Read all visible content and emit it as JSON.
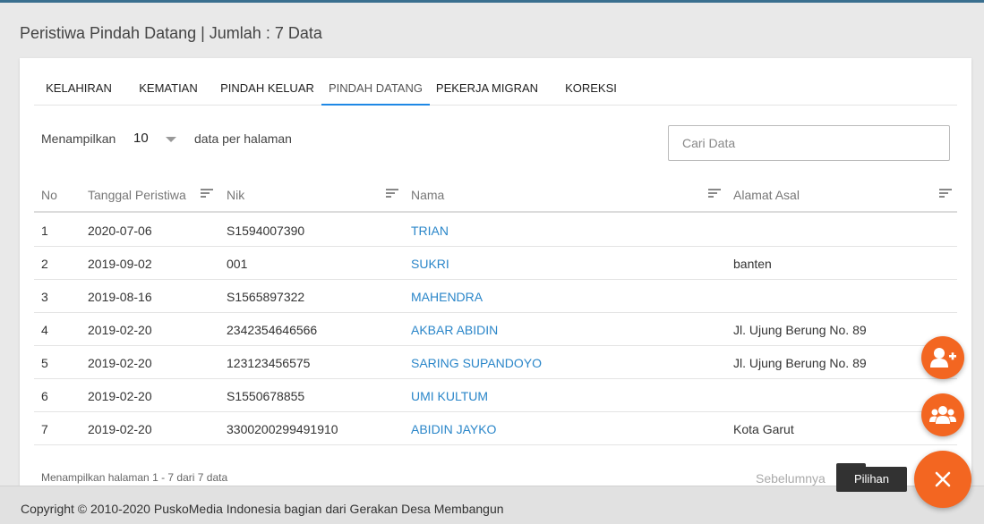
{
  "page": {
    "title": "Peristiwa Pindah Datang | Jumlah : 7 Data"
  },
  "tabs": [
    {
      "label": "KELAHIRAN"
    },
    {
      "label": "KEMATIAN"
    },
    {
      "label": "PINDAH KELUAR"
    },
    {
      "label": "PINDAH DATANG",
      "active": true
    },
    {
      "label": "PEKERJA MIGRAN"
    },
    {
      "label": "KOREKSI"
    }
  ],
  "controls": {
    "show_label": "Menampilkan",
    "page_size": "10",
    "per_page_label": "data per halaman",
    "search_placeholder": "Cari Data"
  },
  "table": {
    "columns": [
      "No",
      "Tanggal Peristiwa",
      "Nik",
      "Nama",
      "Alamat Asal"
    ],
    "rows": [
      {
        "no": "1",
        "tanggal": "2020-07-06",
        "nik": "S1594007390",
        "nama": "TRIAN",
        "alamat": ""
      },
      {
        "no": "2",
        "tanggal": "2019-09-02",
        "nik": "001",
        "nama": "SUKRI",
        "alamat": "banten"
      },
      {
        "no": "3",
        "tanggal": "2019-08-16",
        "nik": "S1565897322",
        "nama": "MAHENDRA",
        "alamat": ""
      },
      {
        "no": "4",
        "tanggal": "2019-02-20",
        "nik": "2342354646566",
        "nama": "AKBAR ABIDIN",
        "alamat": "Jl. Ujung Berung No. 89"
      },
      {
        "no": "5",
        "tanggal": "2019-02-20",
        "nik": "123123456575",
        "nama": "SARING SUPANDOYO",
        "alamat": "Jl. Ujung Berung No. 89"
      },
      {
        "no": "6",
        "tanggal": "2019-02-20",
        "nik": "S1550678855",
        "nama": "UMI KULTUM",
        "alamat": ""
      },
      {
        "no": "7",
        "tanggal": "2019-02-20",
        "nik": "3300200299491910",
        "nama": "ABIDIN JAYKO",
        "alamat": "Kota Garut"
      }
    ]
  },
  "pagination": {
    "info": "Menampilkan halaman 1 - 7 dari 7 data",
    "prev_label": "Sebelumnya"
  },
  "fab": {
    "tooltip": "Pilihan",
    "icons": [
      "add-user-icon",
      "users-group-icon",
      "close-icon"
    ],
    "color": "#f36621"
  },
  "footer": {
    "text": "Copyright © 2010-2020 PuskoMedia Indonesia bagian dari Gerakan Desa Membangun"
  },
  "colors": {
    "accent": "#1e88e5",
    "link": "#2a86c9",
    "fab": "#f36621"
  }
}
